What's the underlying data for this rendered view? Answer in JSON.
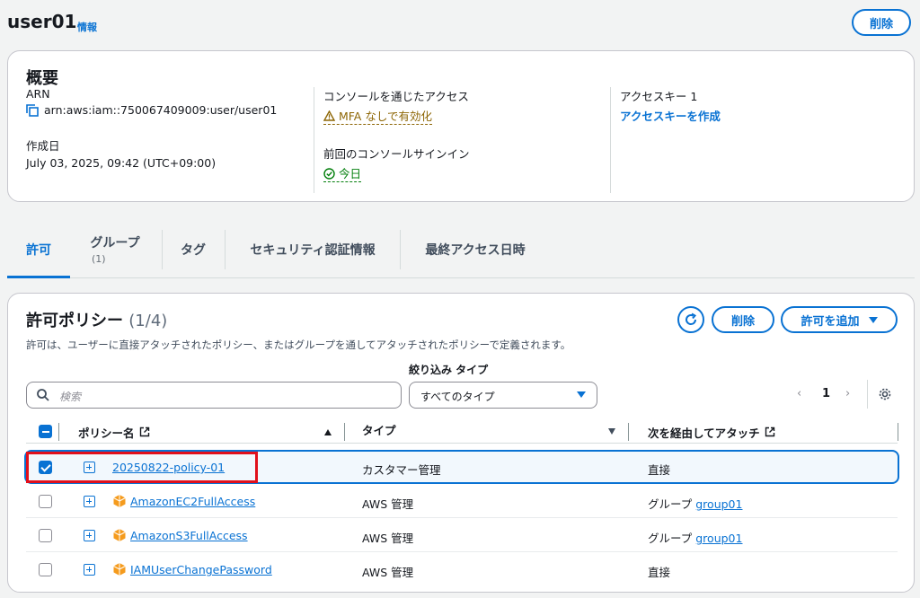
{
  "header": {
    "title": "user01",
    "info": "情報",
    "delete_label": "削除"
  },
  "summary": {
    "title": "概要",
    "arn_label": "ARN",
    "arn_value": "arn:aws:iam::750067409009:user/user01",
    "created_label": "作成日",
    "created_value": "July 03, 2025, 09:42 (UTC+09:00)",
    "console_access_label": "コンソールを通じたアクセス",
    "console_access_value": "MFA なしで有効化",
    "last_signin_label": "前回のコンソールサインイン",
    "last_signin_value": "今日",
    "access_key_label": "アクセスキー 1",
    "access_key_value": "アクセスキーを作成"
  },
  "tabs": [
    {
      "label": "許可",
      "sub": ""
    },
    {
      "label": "グループ",
      "sub": "(1)"
    },
    {
      "label": "タグ",
      "sub": ""
    },
    {
      "label": "セキュリティ認証情報",
      "sub": ""
    },
    {
      "label": "最終アクセス日時",
      "sub": ""
    }
  ],
  "policies": {
    "title": "許可ポリシー",
    "count": "(1/4)",
    "description": "許可は、ユーザーに直接アタッチされたポリシー、またはグループを通してアタッチされたポリシーで定義されます。",
    "delete_label": "削除",
    "add_label": "許可を追加",
    "filter_label": "絞り込み タイプ",
    "search_placeholder": "検索",
    "type_select": "すべてのタイプ",
    "page": "1",
    "columns": {
      "name": "ポリシー名",
      "type": "タイプ",
      "attached": "次を経由してアタッチ"
    },
    "rows": [
      {
        "name": "20250822-policy-01",
        "type": "カスタマー管理",
        "attached_prefix": "直接",
        "attached_link": "",
        "aws": false,
        "checked": true
      },
      {
        "name": "AmazonEC2FullAccess",
        "type": "AWS 管理",
        "attached_prefix": "グループ",
        "attached_link": "group01",
        "aws": true,
        "checked": false
      },
      {
        "name": "AmazonS3FullAccess",
        "type": "AWS 管理",
        "attached_prefix": "グループ",
        "attached_link": "group01",
        "aws": true,
        "checked": false
      },
      {
        "name": "IAMUserChangePassword",
        "type": "AWS 管理",
        "attached_prefix": "直接",
        "attached_link": "",
        "aws": true,
        "checked": false
      }
    ]
  },
  "colors": {
    "accent": "#0972d3",
    "warning": "#8d6605",
    "success": "#037f0c",
    "highlight": "#e0101c"
  },
  "icons": [
    "copy-icon",
    "warning-icon",
    "check-circle-icon",
    "refresh-icon",
    "caret-down-icon",
    "search-icon",
    "chevron-left-icon",
    "chevron-right-icon",
    "settings-icon",
    "external-link-icon",
    "sort-up-icon",
    "sort-down-icon",
    "expand-icon",
    "aws-managed-icon"
  ]
}
